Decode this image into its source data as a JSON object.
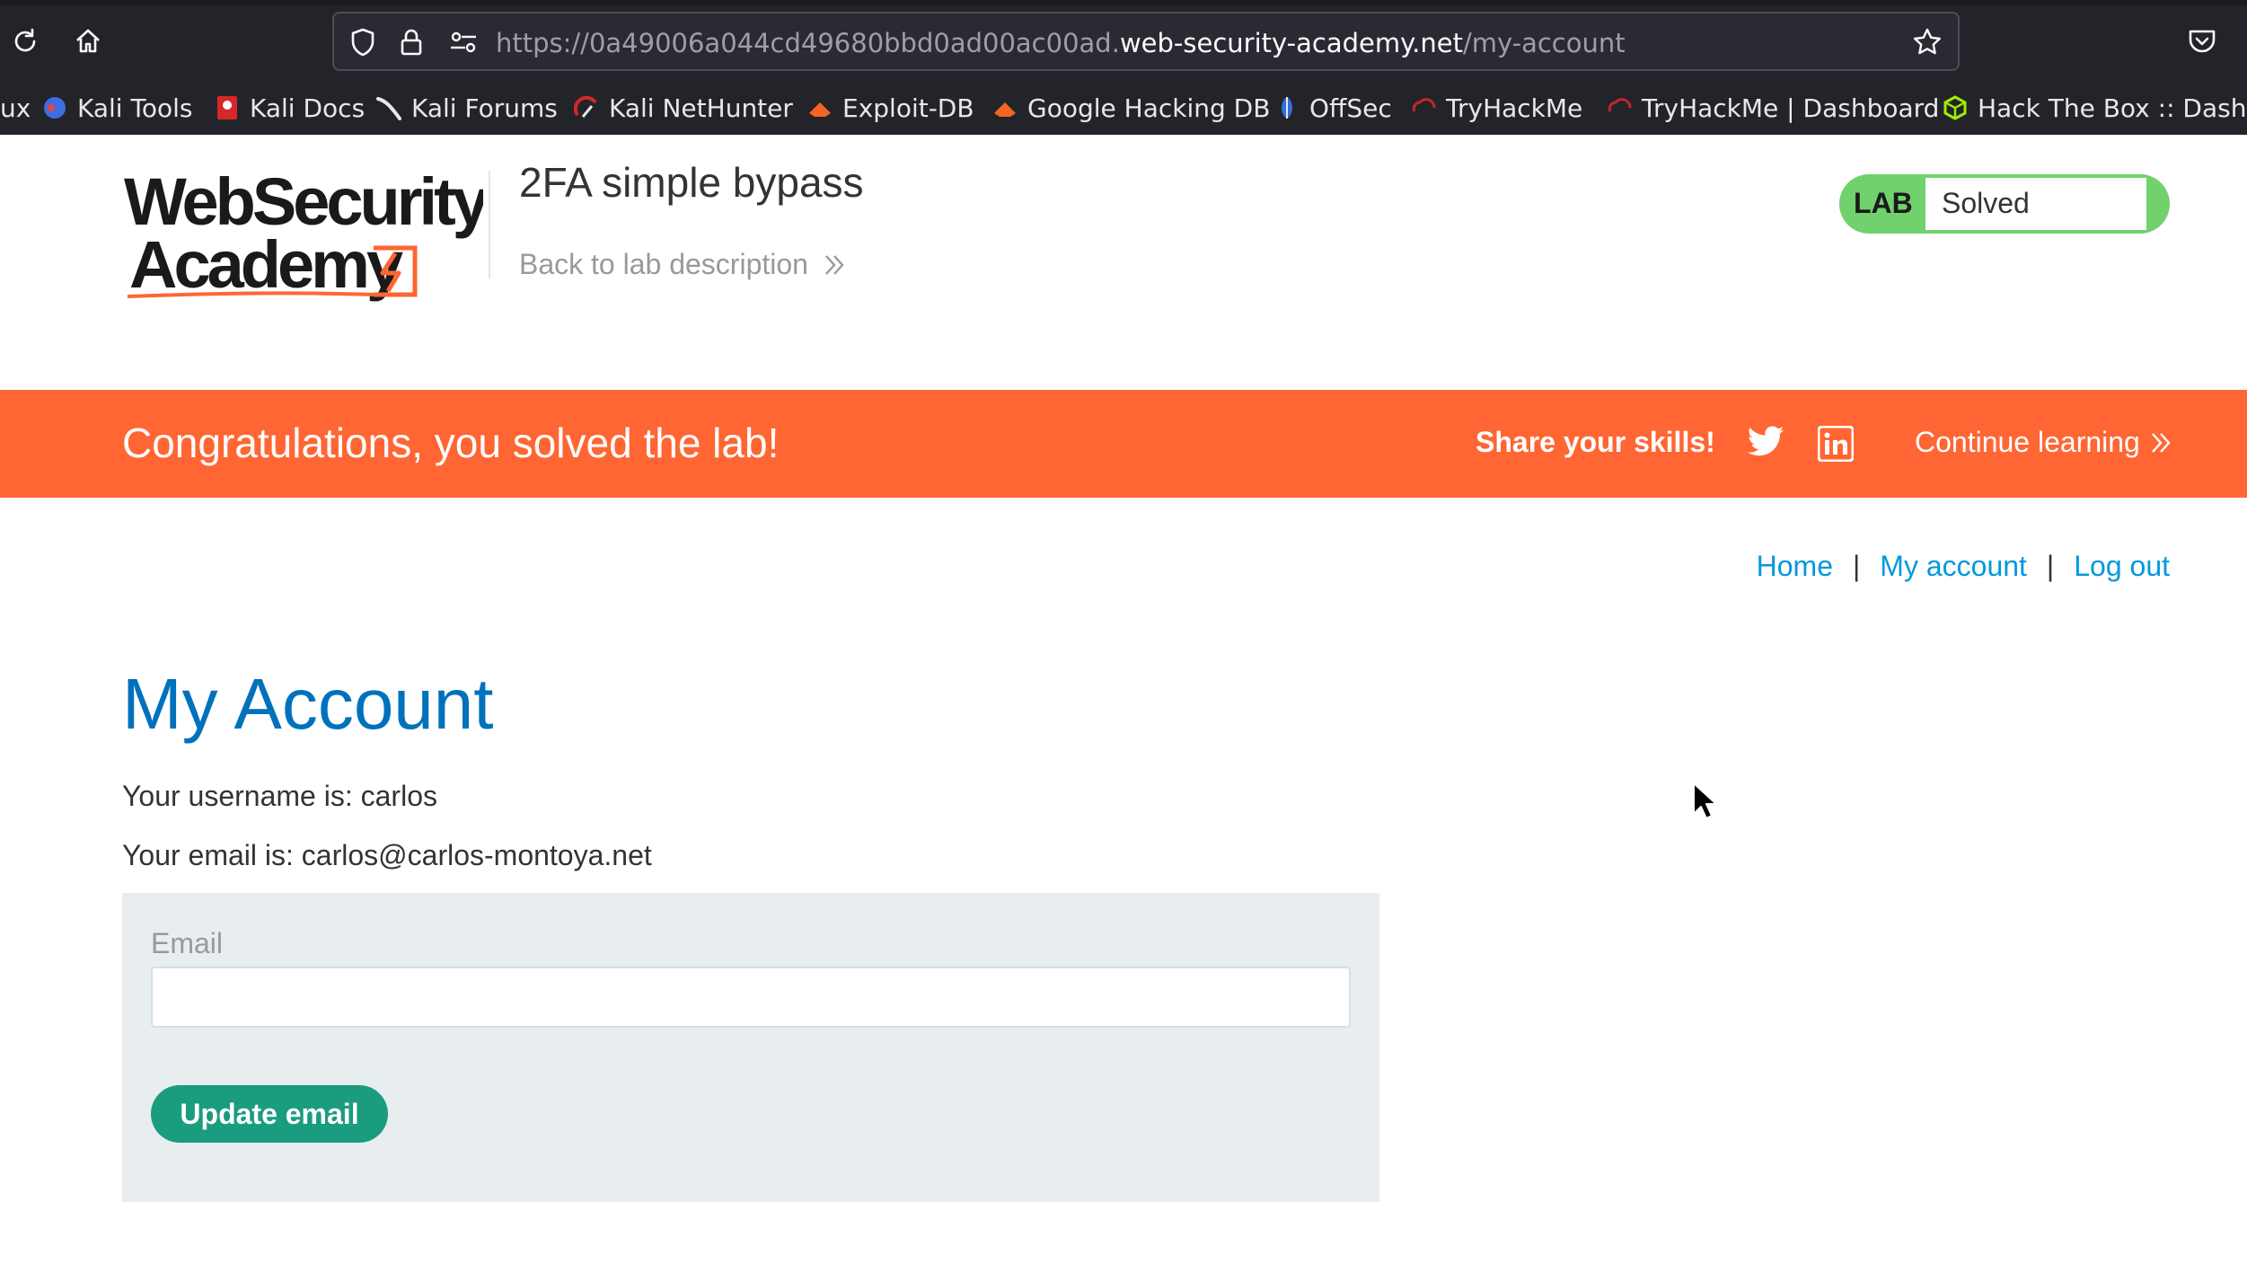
{
  "browser": {
    "url_prefix": "https://0a49006a044cd49680bbd0ad00ac00ad.",
    "url_domain": "web-security-academy.net",
    "url_path": "/my-account",
    "bookmarks": [
      {
        "label": "ux",
        "icon": "kali-icon"
      },
      {
        "label": "Kali Tools",
        "icon": "kali-tools-icon"
      },
      {
        "label": "Kali Docs",
        "icon": "kali-docs-icon"
      },
      {
        "label": "Kali Forums",
        "icon": "kali-forums-icon"
      },
      {
        "label": "Kali NetHunter",
        "icon": "nethunter-icon"
      },
      {
        "label": "Exploit-DB",
        "icon": "exploit-db-icon"
      },
      {
        "label": "Google Hacking DB",
        "icon": "ghdb-icon"
      },
      {
        "label": "OffSec",
        "icon": "offsec-icon"
      },
      {
        "label": "TryHackMe",
        "icon": "tryhackme-icon"
      },
      {
        "label": "TryHackMe | Dashboard",
        "icon": "tryhackme-icon"
      },
      {
        "label": "Hack The Box :: Dashb...",
        "icon": "hackthebox-icon"
      }
    ]
  },
  "header": {
    "logo_line1": "WebSecurity",
    "logo_line2": "Academy",
    "lab_title": "2FA simple bypass",
    "back_link": "Back to lab description",
    "lab_badge": "LAB",
    "lab_status": "Solved"
  },
  "banner": {
    "congrats": "Congratulations, you solved the lab!",
    "share": "Share your skills!",
    "continue": "Continue learning"
  },
  "nav": {
    "home": "Home",
    "separator": "|",
    "my_account": "My account",
    "log_out": "Log out"
  },
  "account": {
    "heading": "My Account",
    "username_line": "Your username is: carlos",
    "email_line": "Your email is: carlos@carlos-montoya.net"
  },
  "form": {
    "email_label": "Email",
    "email_value": "",
    "button_label": "Update email"
  },
  "colors": {
    "banner": "#ff6633",
    "heading": "#0071bc",
    "link": "#0099dd",
    "button": "#1a9c7e",
    "lab_solved": "#70d16d"
  }
}
